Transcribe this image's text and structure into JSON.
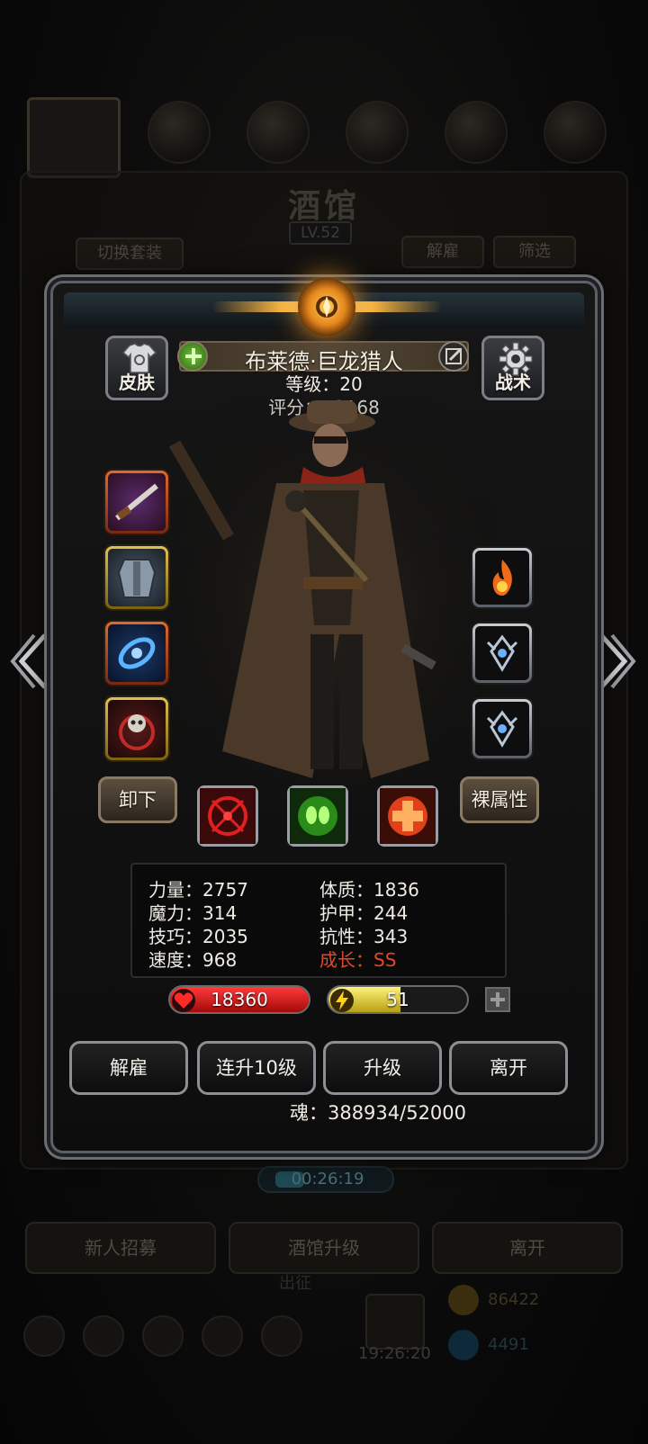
{
  "background": {
    "title": "酒馆",
    "level": "LV.52",
    "switch_outfit": "切换套装",
    "dismiss": "解雇",
    "filter": "筛选",
    "timer": "00:26:19",
    "buttons": [
      "新人招募",
      "酒馆升级",
      "离开"
    ],
    "clock": "19:26:20",
    "gold": "86422",
    "gems": "4491",
    "faint_label": "出征"
  },
  "hero": {
    "name": "布莱德·巨龙猎人",
    "level_line": "等级：20",
    "score_line": "评分：13168",
    "skin_label": "皮肤",
    "tactics_label": "战术"
  },
  "equipment": {
    "left_slots": [
      "rifle-icon",
      "armor-icon",
      "bracer-icon",
      "skull-amulet-icon"
    ],
    "right_slots": [
      "fire-rune-icon",
      "crest-rune-icon",
      "crest-rune-icon"
    ]
  },
  "actions": {
    "unequip": "卸下",
    "base_attr": "裸属性"
  },
  "stats": {
    "strength": "力量：2757",
    "magic": "魔力：314",
    "skill": "技巧：2035",
    "speed": "速度：968",
    "constitution": "体质：1836",
    "armor": "护甲：244",
    "resistance": "抗性：343",
    "growth": "成长：SS"
  },
  "bars": {
    "hp": "18360",
    "energy": "51",
    "energy_fill": 0.52
  },
  "bottom_buttons": {
    "dismiss": "解雇",
    "level_up_10": "连升10级",
    "level_up": "升级",
    "leave": "离开"
  },
  "soul": "魂：388934/52000",
  "colors": {
    "hp": "#d61a1a",
    "energy": "#e0d22a",
    "growth": "#e3462a",
    "accent_gold": "#f5b340"
  }
}
